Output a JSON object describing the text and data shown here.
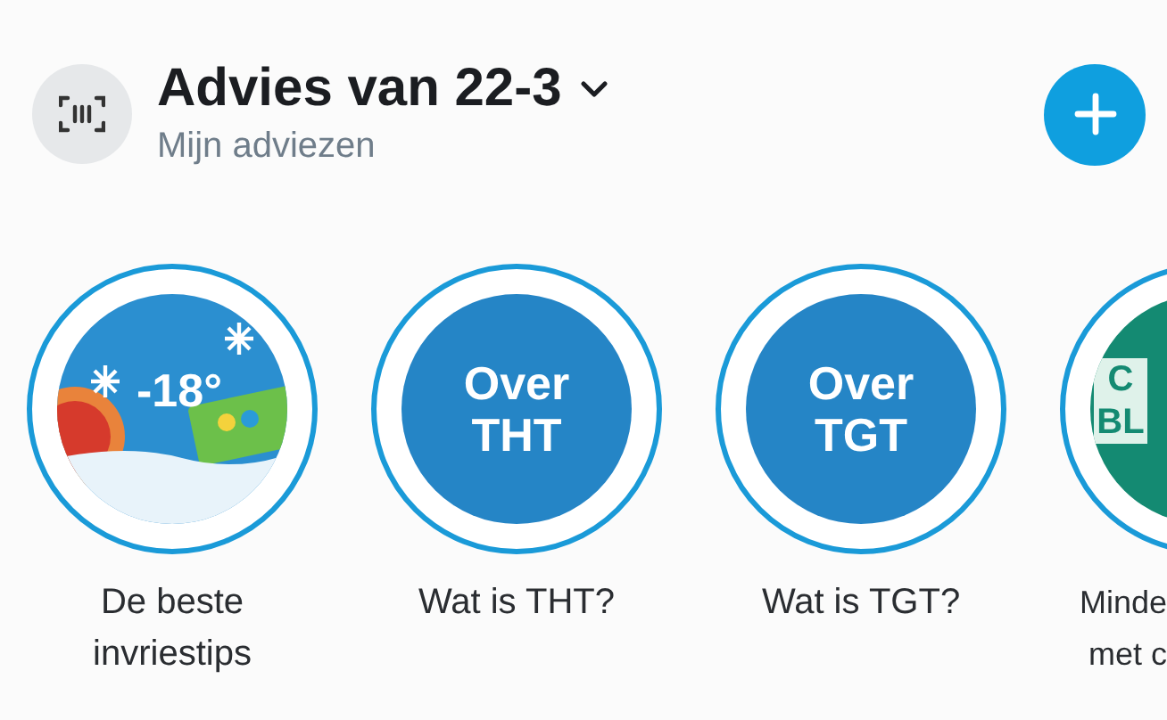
{
  "header": {
    "title": "Advies van 22-3",
    "subtitle": "Mijn adviezen"
  },
  "stories": [
    {
      "kind": "freezer-art",
      "art_text": "-18°",
      "label": [
        "De beste",
        "invriestips"
      ]
    },
    {
      "kind": "text",
      "art_text": "Over THT",
      "label": [
        "Wat is THT?"
      ]
    },
    {
      "kind": "text",
      "art_text": "Over TGT",
      "label": [
        "Wat is TGT?"
      ]
    },
    {
      "kind": "badge-art",
      "art_text": "C BL",
      "label": [
        "Minde",
        "met c"
      ]
    }
  ]
}
